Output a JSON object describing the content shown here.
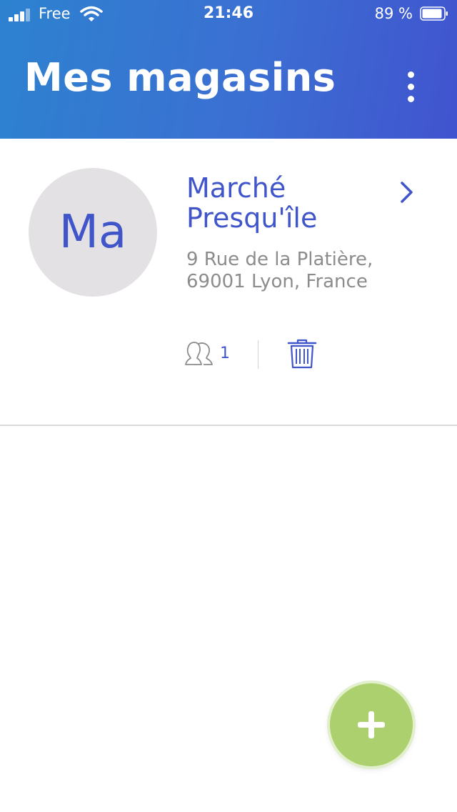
{
  "status_bar": {
    "carrier": "Free",
    "time": "21:46",
    "battery": "89 %"
  },
  "header": {
    "title": "Mes magasins",
    "menu_icon": "more-vertical-icon"
  },
  "store": {
    "avatar_initials": "Ma",
    "name": "Marché Presqu'île",
    "address": "9 Rue de la Platière, 69001 Lyon, France",
    "members_count": "1",
    "members_icon": "members-icon",
    "delete_icon": "trash-icon",
    "open_icon": "chevron-right-icon"
  },
  "fab": {
    "icon": "plus-icon"
  },
  "colors": {
    "accent": "#3f55c9",
    "header_start": "#2d82d0",
    "header_end": "#4153cf",
    "fab": "#acd06e",
    "muted_text": "#8c8c8c"
  }
}
